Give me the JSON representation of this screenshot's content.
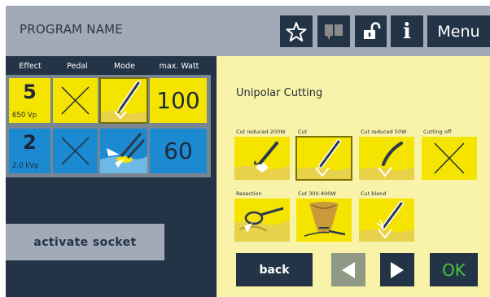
{
  "header": {
    "program_name": "PROGRAM NAME",
    "icons": [
      "star-icon",
      "book-icon",
      "unlock-icon",
      "info-icon"
    ],
    "info_label": "i",
    "menu_label": "Menu"
  },
  "columns": {
    "effect": "Effect",
    "pedal": "Pedal",
    "mode": "Mode",
    "max_watt": "max. Watt"
  },
  "rows": [
    {
      "effect": "5",
      "effect_sub": "650 Vp",
      "max_watt": "100",
      "color": "#f5e400"
    },
    {
      "effect": "2",
      "effect_sub": "2.0 kVp",
      "max_watt": "60",
      "color": "#1c8ad1"
    }
  ],
  "activate_socket": "activate socket",
  "panel": {
    "title": "Unipolar Cutting",
    "options": [
      {
        "label": "Cut reduced 200W",
        "selected": false
      },
      {
        "label": "Cut",
        "selected": true
      },
      {
        "label": "Cut reduced 50W",
        "selected": false
      },
      {
        "label": "Cutting off",
        "selected": false
      },
      {
        "label": "Resection",
        "selected": false
      },
      {
        "label": "Cut 300-400W",
        "selected": false
      },
      {
        "label": "Cut blend",
        "selected": false
      }
    ],
    "back_label": "back",
    "ok_label": "OK"
  },
  "colors": {
    "background": "#233447",
    "header": "#a2aab8",
    "yellow": "#f5e400",
    "blue": "#1c8ad1",
    "panel": "#f8f3a8",
    "ok_green": "#46c33c"
  }
}
